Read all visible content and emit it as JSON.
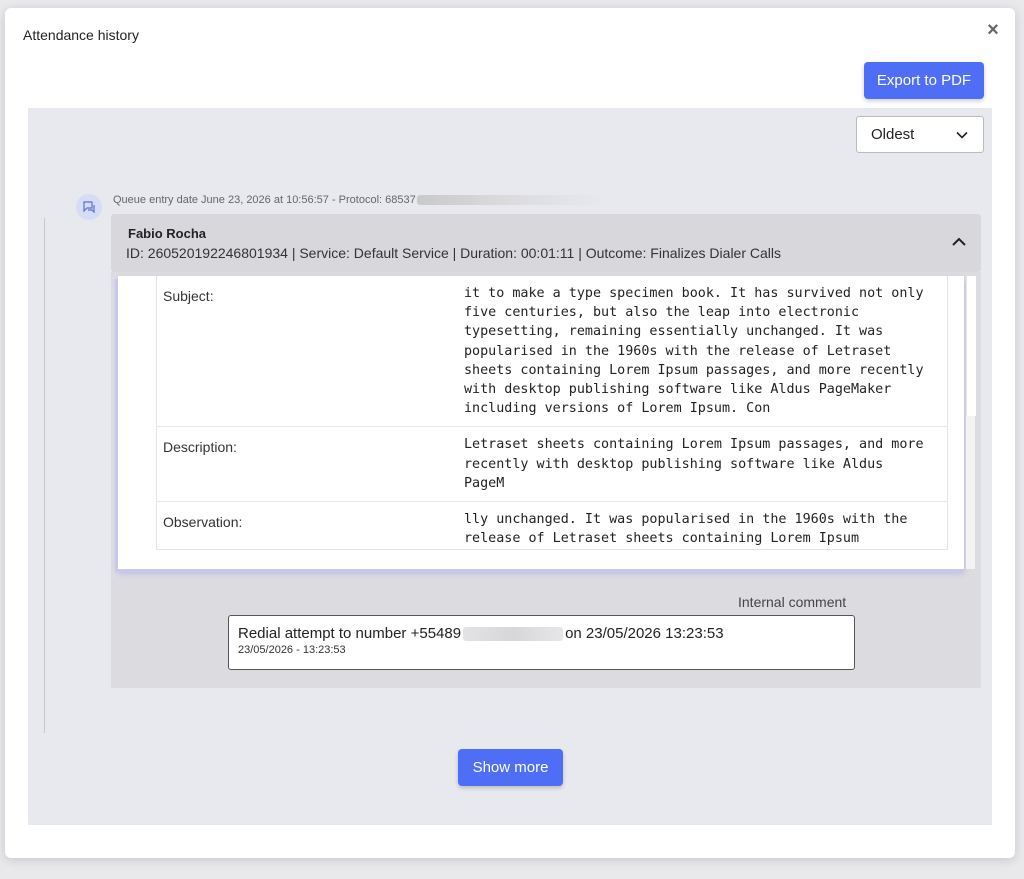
{
  "modal": {
    "title": "Attendance history",
    "close_label": "×",
    "export_label": "Export to PDF"
  },
  "sort": {
    "selected": "Oldest"
  },
  "entry": {
    "queue_meta": "Queue entry date June 23, 2026 at 10:56:57 - Protocol: 68537",
    "agent_name": "Fabio Rocha",
    "meta_line": "ID: 260520192246801934 | Service: Default Service | Duration: 00:01:11 | Outcome: Finalizes Dialer Calls",
    "fields": [
      {
        "label": "Subject:",
        "value": "it to make a type specimen book. It has survived not only five centuries, but also the leap into electronic typesetting, remaining essentially unchanged. It was popularised in the 1960s with the release of Letraset sheets containing Lorem Ipsum passages, and more recently with desktop publishing software like Aldus PageMaker including versions of Lorem Ipsum. Con"
      },
      {
        "label": "Description:",
        "value": "Letraset sheets containing Lorem Ipsum passages, and more recently with desktop publishing software like Aldus PageM"
      },
      {
        "label": "Observation:",
        "value": "lly unchanged. It was popularised in the 1960s with the release of Letraset sheets containing Lorem Ipsum"
      }
    ],
    "internal_comment_label": "Internal comment",
    "comment_prefix": "Redial attempt to number +55489",
    "comment_suffix": "on 23/05/2026 13:23:53",
    "comment_date": "23/05/2026 - 13:23:53"
  },
  "show_more_label": "Show more",
  "colors": {
    "primary": "#4d6ef5",
    "panel_bg": "#e8e9ef",
    "header_bg": "#d8d8dc"
  }
}
